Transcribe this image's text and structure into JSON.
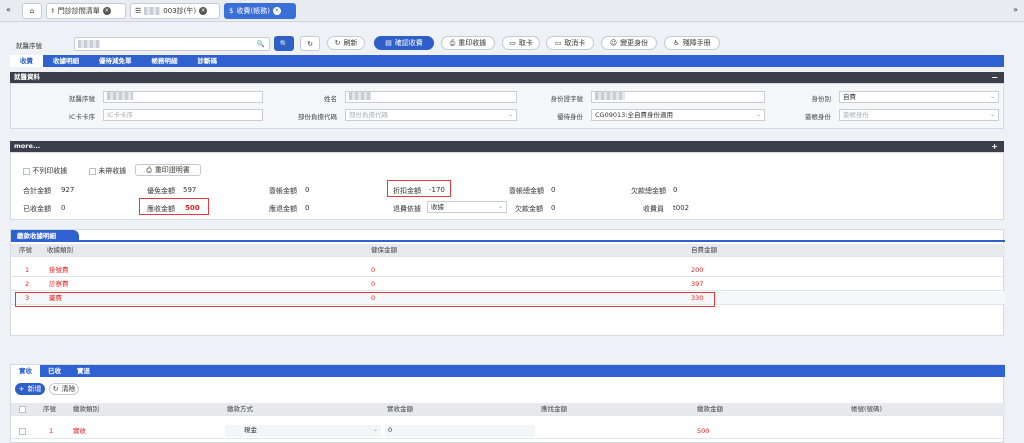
{
  "tabs": [
    {
      "label": "門診診間清單"
    },
    {
      "label": "003診(午)"
    },
    {
      "label": "收費(帳務)"
    }
  ],
  "toolbar": {
    "visit_no_label": "就醫序號",
    "new_label": "刷新",
    "confirm_label": "確認收費",
    "reprint_label": "重印收據",
    "getcard_label": "取卡",
    "cancelcard_label": "取消卡",
    "changeid_label": "變更身份",
    "manual_label": "殘障手冊"
  },
  "nav": [
    "收費",
    "收據明細",
    "優待減免單",
    "帳務明細",
    "診斷碼"
  ],
  "info": {
    "title": "就醫資料",
    "visit_no_label": "就醫序號",
    "name_label": "姓名",
    "id_label": "身份證字號",
    "idtype_label": "身份別",
    "idtype_value": "自費",
    "iccard_label": "IC卡卡序",
    "iccard_placeholder": "IC卡卡序",
    "partial_label": "部份負擔代碼",
    "partial_placeholder": "部份負擔代碼",
    "discount_label": "優待身份",
    "discount_value": "CG09013:全自費身份適用",
    "acct_label": "簽帳身份",
    "acct_placeholder": "簽帳身份"
  },
  "more": {
    "title": "more...",
    "noprint_label": "不列印收據",
    "nocarry_label": "未帶收據",
    "reprint_cert_label": "重印證明書",
    "total_label": "合計金額",
    "total_value": "927",
    "waive_label": "優免金額",
    "waive_value": "597",
    "sign_label": "簽帳金額",
    "sign_value": "0",
    "discount_label": "折扣金額",
    "discount_value": "-170",
    "signtotal_label": "簽帳總金額",
    "signtotal_value": "0",
    "owetotal_label": "欠款總金額",
    "owetotal_value": "0",
    "received_label": "已收金額",
    "received_value": "0",
    "due_label": "應收金額",
    "due_value": "500",
    "refund_label": "應退金額",
    "refund_value": "0",
    "refundby_label": "退費依據",
    "refundby_value": "收據",
    "owe_label": "欠款金額",
    "owe_value": "0",
    "cashier_label": "收費員",
    "cashier_value": "t002"
  },
  "detail": {
    "title": "繳款收據明細",
    "headers": [
      "序號",
      "收據類別",
      "健保金額",
      "自費金額"
    ],
    "rows": [
      {
        "no": "1",
        "type": "掛號費",
        "nhi": "0",
        "self": "200"
      },
      {
        "no": "2",
        "type": "診察費",
        "nhi": "0",
        "self": "397"
      },
      {
        "no": "3",
        "type": "藥費",
        "nhi": "0",
        "self": "330"
      }
    ]
  },
  "pay": {
    "tabs": [
      "實收",
      "已收",
      "實退"
    ],
    "add_label": "新增",
    "clear_label": "清除",
    "headers": [
      "序號",
      "繳款類別",
      "繳款方式",
      "實收金額",
      "應找金額",
      "繳款金額",
      "帳號(號碼)"
    ],
    "rows": [
      {
        "no": "1",
        "type": "實收",
        "method": "現金",
        "received": "0",
        "amount": "500"
      }
    ]
  },
  "colors": {
    "primary": "#2f62d0",
    "danger": "#e02020",
    "dark": "#3a3f4b"
  }
}
